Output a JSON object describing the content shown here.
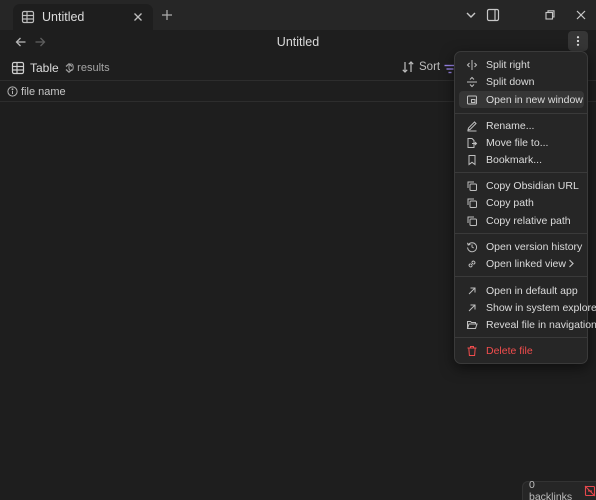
{
  "tab": {
    "label": "Untitled",
    "icon": "table-icon"
  },
  "header": {
    "title": "Untitled"
  },
  "toolbar": {
    "view_label": "Table",
    "results": "0 results",
    "sort_label": "Sort"
  },
  "table": {
    "column": "file name"
  },
  "status": {
    "backlinks": "0 backlinks"
  },
  "colors": {
    "accent": "#9a85ea",
    "danger": "#f24d4d",
    "background": "#1e1e1e",
    "menu_bg": "#262626"
  },
  "menu": {
    "items": [
      {
        "label": "Split right",
        "icon": "split-right-icon"
      },
      {
        "label": "Split down",
        "icon": "split-down-icon"
      },
      {
        "label": "Open in new window",
        "icon": "new-window-icon",
        "highlighted": true
      },
      {
        "label": "Rename...",
        "icon": "pencil-icon"
      },
      {
        "label": "Move file to...",
        "icon": "move-file-icon"
      },
      {
        "label": "Bookmark...",
        "icon": "bookmark-icon"
      },
      {
        "label": "Copy Obsidian URL",
        "icon": "copy-icon"
      },
      {
        "label": "Copy path",
        "icon": "copy-icon"
      },
      {
        "label": "Copy relative path",
        "icon": "copy-icon"
      },
      {
        "label": "Open version history",
        "icon": "history-icon"
      },
      {
        "label": "Open linked view",
        "icon": "link-icon",
        "submenu": true
      },
      {
        "label": "Open in default app",
        "icon": "arrow-up-right-icon"
      },
      {
        "label": "Show in system explorer",
        "icon": "arrow-up-right-icon"
      },
      {
        "label": "Reveal file in navigation",
        "icon": "folder-open-icon"
      },
      {
        "label": "Delete file",
        "icon": "trash-icon",
        "danger": true
      }
    ]
  }
}
